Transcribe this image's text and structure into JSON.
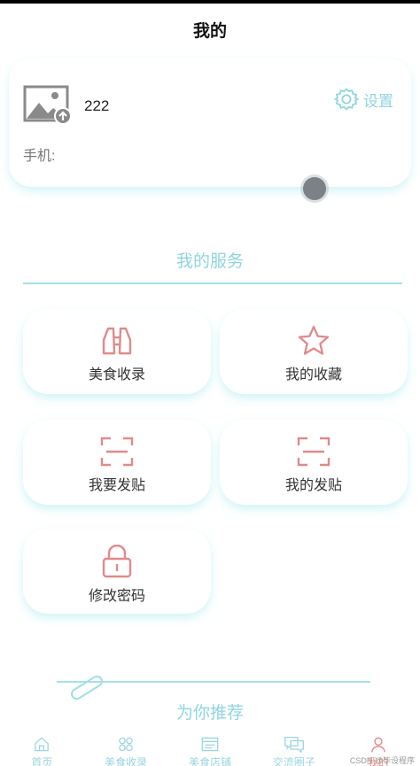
{
  "header": {
    "title": "我的"
  },
  "profile": {
    "username": "222",
    "phone_label": "手机:",
    "settings_label": "设置"
  },
  "services": {
    "title": "我的服务",
    "items": [
      {
        "label": "美食收录",
        "icon": "binoculars-icon"
      },
      {
        "label": "我的收藏",
        "icon": "star-icon"
      },
      {
        "label": "我要发贴",
        "icon": "scan-frame-icon"
      },
      {
        "label": "我的发贴",
        "icon": "scan-frame-icon"
      },
      {
        "label": "修改密码",
        "icon": "lock-icon"
      }
    ]
  },
  "recommend": {
    "title": "为你推荐"
  },
  "tabbar": {
    "items": [
      {
        "label": "首页",
        "icon": "home-icon"
      },
      {
        "label": "美食收录",
        "icon": "grid-icon"
      },
      {
        "label": "美食店铺",
        "icon": "store-icon"
      },
      {
        "label": "交流圈子",
        "icon": "chat-icon"
      },
      {
        "label": "我的",
        "icon": "user-icon",
        "active": true
      }
    ]
  },
  "watermark": "CSDN @毕设程序",
  "colors": {
    "accent": "#8fd5e0",
    "icon": "#e08a8a",
    "shadow": "#b4ecf0"
  }
}
